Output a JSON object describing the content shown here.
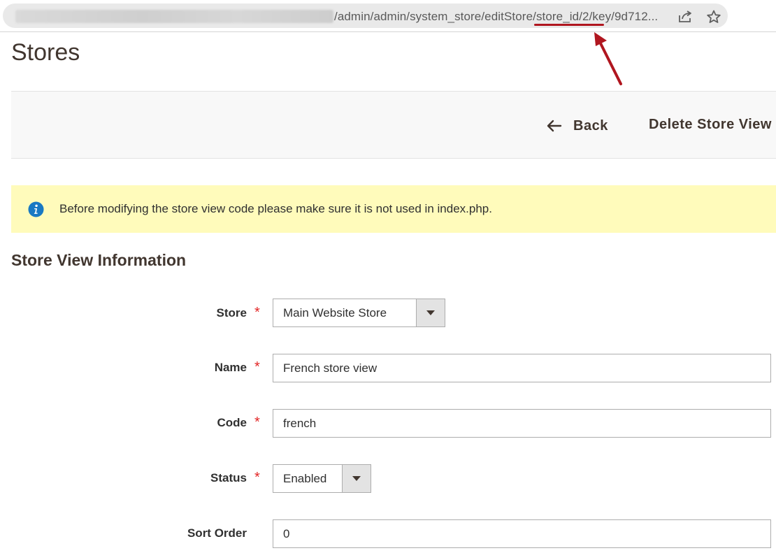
{
  "browser": {
    "url_visible": "/admin/admin/system_store/editStore/store_id/2/key/9d712..."
  },
  "page": {
    "title": "Stores"
  },
  "actions": {
    "back_label": "Back",
    "delete_label": "Delete Store View"
  },
  "notice": {
    "text": "Before modifying the store view code please make sure it is not used in index.php."
  },
  "section": {
    "title": "Store View Information"
  },
  "form": {
    "store": {
      "label": "Store",
      "required_mark": "*",
      "value": "Main Website Store"
    },
    "name": {
      "label": "Name",
      "required_mark": "*",
      "value": "French store view"
    },
    "code": {
      "label": "Code",
      "required_mark": "*",
      "value": "french"
    },
    "status": {
      "label": "Status",
      "required_mark": "*",
      "value": "Enabled"
    },
    "sort_order": {
      "label": "Sort Order",
      "value": "0"
    }
  },
  "colors": {
    "notice_bg": "#fffbbb",
    "required": "#e22626",
    "info_icon": "#1979c3",
    "annotation": "#b0161f"
  },
  "icons": [
    "share-icon",
    "star-icon",
    "back-arrow-icon",
    "info-icon",
    "chevron-down-icon"
  ]
}
